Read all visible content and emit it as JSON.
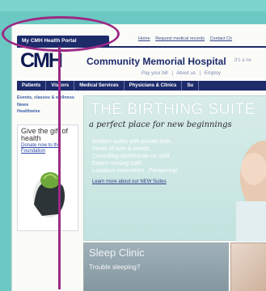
{
  "header": {
    "portal_tab": "My CMH Health Portal",
    "top_links": [
      "Home",
      "Request medical records",
      "Contact Ch"
    ],
    "logo": "CMH",
    "hospital_name": "Community Memorial Hospital",
    "tagline": "It's a ne",
    "sub_links": [
      "Pay your bill",
      "|",
      "About us",
      "|",
      "Employ"
    ]
  },
  "nav": {
    "items": [
      "Patients",
      "Visitors",
      "Medical Services",
      "Physicians & Clinics",
      "Su"
    ]
  },
  "left": {
    "title": "Events, classes & wellness",
    "links": [
      "News",
      "Healthwise"
    ],
    "give_text": "Give the gift of health",
    "donate_link": "Donate now to the Foundation"
  },
  "hero": {
    "title": "THE BIRTHING SUITE",
    "subtitle": "a perfect place for new beginnings",
    "items": [
      "Modern suites with private bath...",
      "Views of river & woods...",
      "Consulting obstetrician on staff...",
      "Expert nursing staff...",
      "Lactation counselors...Pampering!"
    ],
    "link": "Learn more about our NEW Suites"
  },
  "promo": {
    "sleep_title": "Sleep Clinic",
    "sleep_sub": "Trouble sleeping?"
  },
  "colors": {
    "accent": "#1d2b6b",
    "highlight": "#9c2a85",
    "background": "#6cc8c2"
  }
}
